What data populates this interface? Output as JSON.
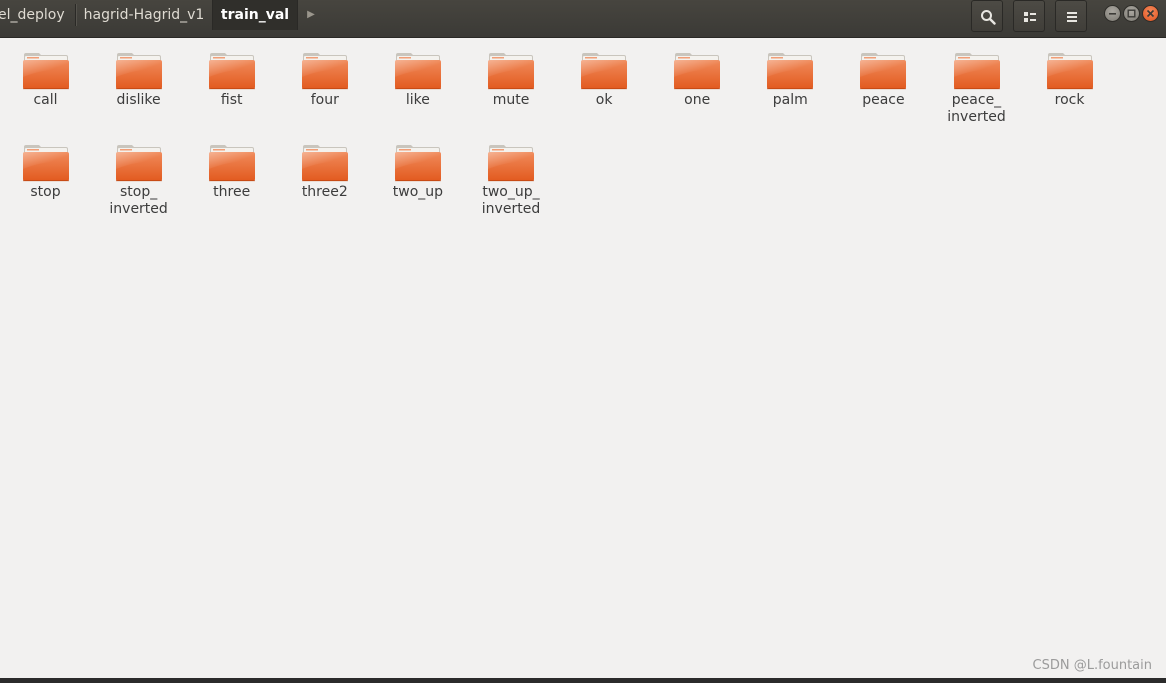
{
  "breadcrumbs": {
    "items": [
      "el_deploy",
      "hagrid-Hagrid_v1",
      "train_val"
    ],
    "active_index": 2
  },
  "toolbar": {
    "search_icon": "search-icon",
    "view_icon": "view-list-icon",
    "menu_icon": "hamburger-menu-icon"
  },
  "window_controls": [
    "minimize-icon",
    "maximize-icon",
    "close-icon"
  ],
  "colors": {
    "folder_top": "#f08a5a",
    "folder_bottom": "#e25a1f",
    "folder_tab": "#f4f2ee",
    "window_close": "#e95420"
  },
  "folders": [
    {
      "label": "call"
    },
    {
      "label": "dislike"
    },
    {
      "label": "fist"
    },
    {
      "label": "four"
    },
    {
      "label": "like"
    },
    {
      "label": "mute"
    },
    {
      "label": "ok"
    },
    {
      "label": "one"
    },
    {
      "label": "palm"
    },
    {
      "label": "peace"
    },
    {
      "label": "peace_\ninverted"
    },
    {
      "label": "rock"
    },
    {
      "label": "stop"
    },
    {
      "label": "stop_\ninverted"
    },
    {
      "label": "three"
    },
    {
      "label": "three2"
    },
    {
      "label": "two_up"
    },
    {
      "label": "two_up_\ninverted"
    }
  ],
  "watermark": "CSDN @L.fountain"
}
